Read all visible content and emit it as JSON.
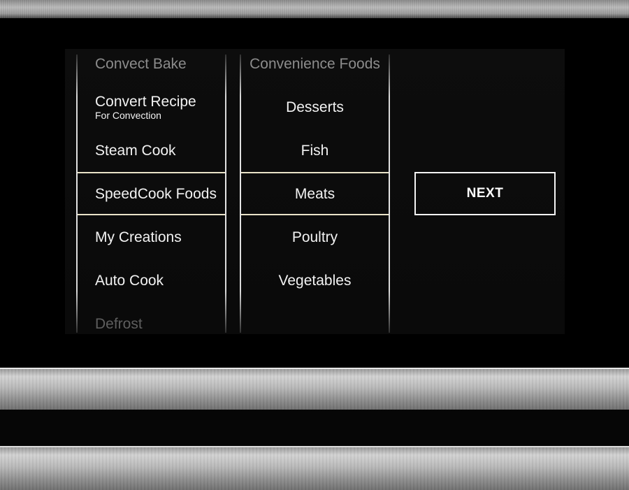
{
  "category_list": {
    "items": [
      {
        "label": "Convect Bake",
        "sub": ""
      },
      {
        "label": "Convert Recipe",
        "sub": "For Convection"
      },
      {
        "label": "Steam Cook",
        "sub": ""
      },
      {
        "label": "SpeedCook Foods",
        "sub": ""
      },
      {
        "label": "My Creations",
        "sub": ""
      },
      {
        "label": "Auto Cook",
        "sub": ""
      },
      {
        "label": "Defrost",
        "sub": ""
      }
    ],
    "selected": "SpeedCook Foods"
  },
  "food_list": {
    "items": [
      {
        "label": "Convenience Foods"
      },
      {
        "label": "Desserts"
      },
      {
        "label": "Fish"
      },
      {
        "label": "Meats"
      },
      {
        "label": "Poultry"
      },
      {
        "label": "Vegetables"
      }
    ],
    "selected": "Meats"
  },
  "actions": {
    "next_label": "NEXT"
  }
}
